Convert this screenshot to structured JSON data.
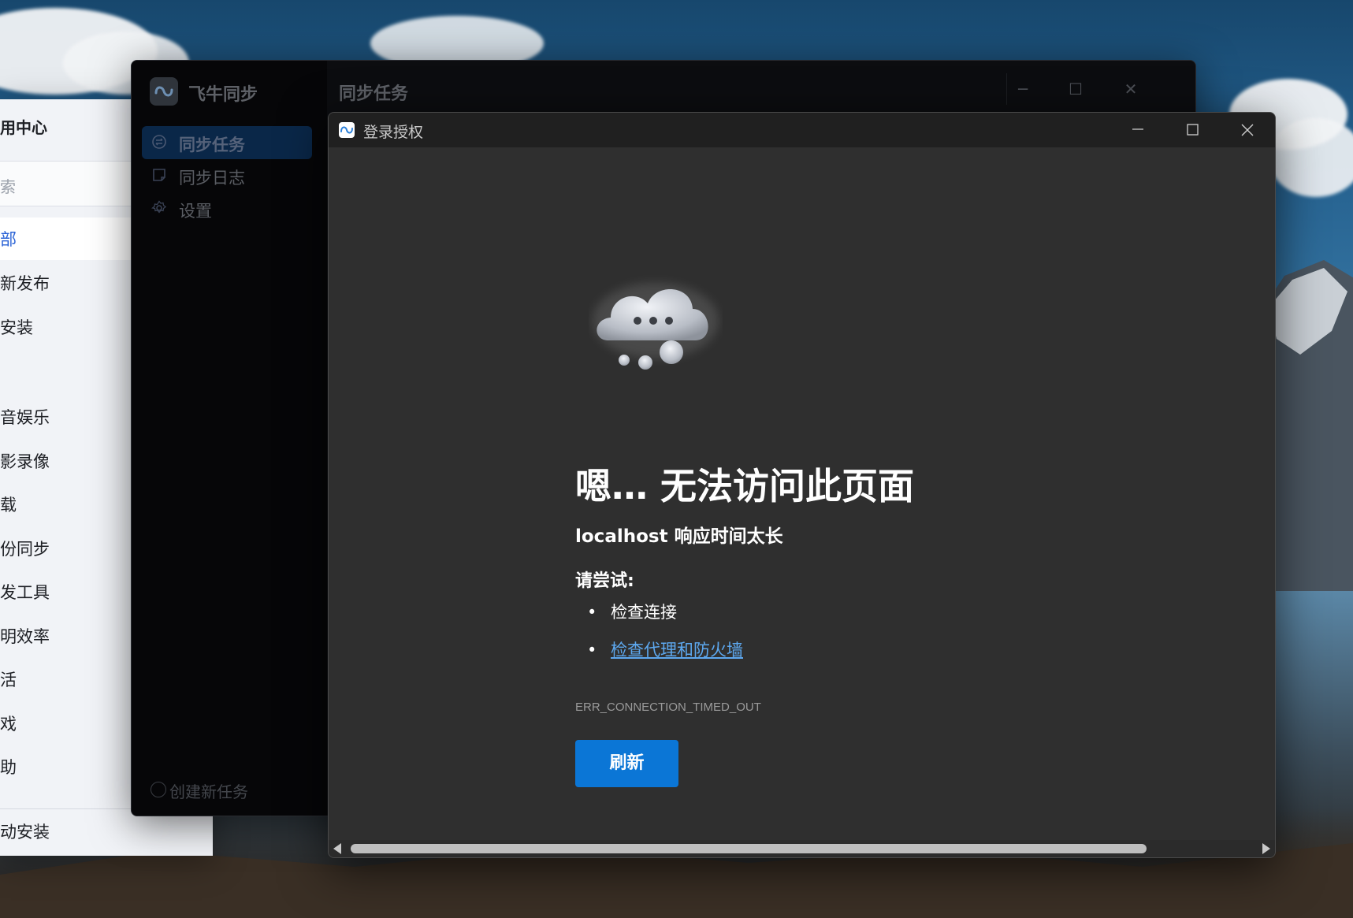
{
  "app_center": {
    "title": "用中心",
    "search_placeholder": "索",
    "items": [
      {
        "label": "部",
        "active": true
      },
      {
        "label": "新发布"
      },
      {
        "label": "安装"
      },
      {
        "label": "音娱乐"
      },
      {
        "label": "影录像"
      },
      {
        "label": "载"
      },
      {
        "label": "份同步"
      },
      {
        "label": "发工具"
      },
      {
        "label": "明效率"
      },
      {
        "label": "活"
      },
      {
        "label": "戏"
      },
      {
        "label": "助"
      }
    ],
    "bottom_item": "动安装"
  },
  "sync_window": {
    "app_name": "飞牛同步",
    "page_heading": "同步任务",
    "nav": [
      {
        "label": "同步任务",
        "icon": "sync-icon",
        "active": true
      },
      {
        "label": "同步日志",
        "icon": "log-icon"
      },
      {
        "label": "设置",
        "icon": "gear-icon"
      }
    ],
    "create_task_label": "创建新任务",
    "controls": {
      "minimize": "─",
      "maximize": "☐",
      "close": "✕"
    }
  },
  "auth_window": {
    "title": "登录授权",
    "controls": {
      "minimize": "─",
      "maximize": "☐",
      "close": "✕"
    },
    "error_title": "嗯… 无法访问此页面",
    "error_subtitle": "localhost 响应时间太长",
    "try_label": "请尝试:",
    "suggestions": [
      {
        "text": "检查连接",
        "link": false
      },
      {
        "text": "检查代理和防火墙",
        "link": true
      }
    ],
    "error_code": "ERR_CONNECTION_TIMED_OUT",
    "refresh_label": "刷新"
  },
  "colors": {
    "accent_blue": "#0b76d6",
    "link_blue": "#5da8ef",
    "nav_active_bg": "#0a2748",
    "content_bg": "#2f2f2f"
  }
}
